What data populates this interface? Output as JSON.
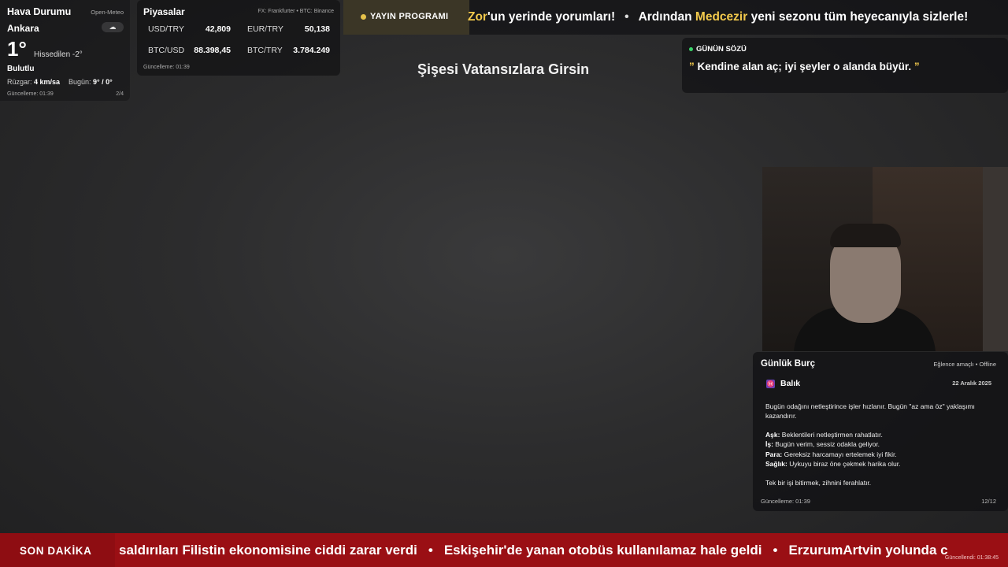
{
  "weather": {
    "title": "Hava Durumu",
    "source": "Open-Meteo",
    "city": "Ankara",
    "icon": "cloud-icon",
    "icon_glyph": "☁",
    "temperature": "1°",
    "feels_like": "Hissedilen -2°",
    "condition": "Bulutlu",
    "wind_label": "Rüzgar:",
    "wind_value": "4 km/sa",
    "today_label": "Bugün:",
    "today_value": "9° / 0°",
    "updated": "Güncelleme: 01:39",
    "page": "2/4"
  },
  "markets": {
    "title": "Piyasalar",
    "source": "FX: Frankfurter • BTC: Binance",
    "items": [
      {
        "label": "USD/TRY",
        "value": "42,809"
      },
      {
        "label": "EUR/TRY",
        "value": "50,138"
      },
      {
        "label": "BTC/USD",
        "value": "88.398,45"
      },
      {
        "label": "BTC/TRY",
        "value": "3.784.249"
      }
    ],
    "updated": "Güncelleme: 01:39"
  },
  "program": {
    "label": "YAYIN PROGRAMI",
    "seg1_hl": "Zor",
    "seg1_rest": "'un yerinde yorumları!",
    "separator": "•",
    "seg2_pre": "Ardından ",
    "seg2_hl": "Medcezir",
    "seg2_rest": " yeni sezonu tüm heyecanıyla sizlerle!"
  },
  "song_title": "Şişesi Vatansızlara Girsin",
  "quote": {
    "label": "GÜNÜN SÖZÜ",
    "open_mark": "”",
    "text": " Kendine alan aç; iyi şeyler o alanda büyür. ",
    "close_mark": "”"
  },
  "horoscope": {
    "title": "Günlük Burç",
    "mode": "Eğlence amaçlı • Offline",
    "sign_icon": "pisces-icon",
    "sign_glyph": "♓",
    "sign": "Balık",
    "date": "22 Aralık 2025",
    "intro": "Bugün odağını netleştirince işler hızlanır. Bugün \"az ama öz\" yaklaşımı kazandırır.",
    "rows": [
      {
        "k": "Aşk:",
        "v": " Beklentileri netleştirmen rahatlatır."
      },
      {
        "k": "İş:",
        "v": " Bugün verim, sessiz odakla geliyor."
      },
      {
        "k": "Para:",
        "v": " Gereksiz harcamayı ertelemek iyi fikir."
      },
      {
        "k": "Sağlık:",
        "v": " Uykuyu biraz öne çekmek harika olur."
      }
    ],
    "tip": "Tek bir işi bitirmek, zihnini ferahlatır.",
    "updated": "Güncelleme: 01:39",
    "page": "12/12"
  },
  "breaking": {
    "label": "SON DAKİKA",
    "item1": "saldırıları Filistin ekonomisine ciddi zarar verdi",
    "separator": "•",
    "item2": "Eskişehir'de yanan otobüs kullanılamaz hale geldi",
    "item3": "ErzurumArtvin yolunda c",
    "updated": "Güncellendi: 01:38:45"
  }
}
